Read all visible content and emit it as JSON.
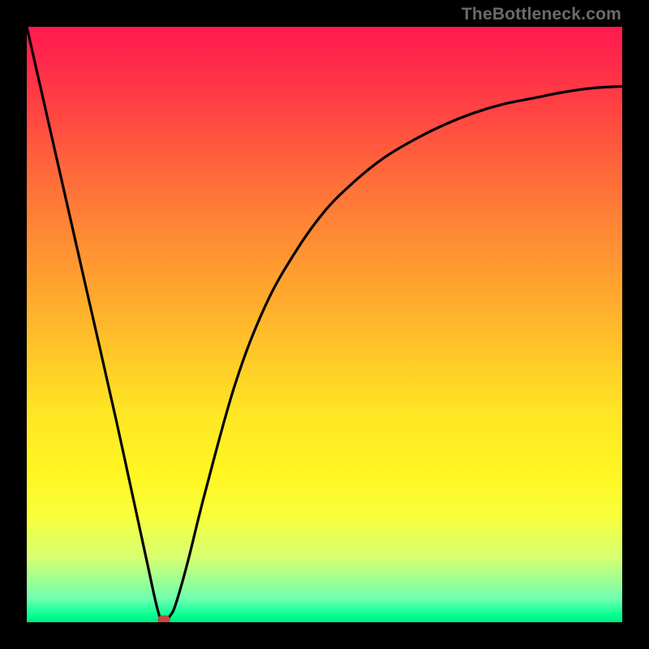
{
  "attribution": "TheBottleneck.com",
  "chart_data": {
    "type": "line",
    "background": "rainbow-gradient",
    "x": [
      0,
      5,
      10,
      15,
      20,
      22,
      23,
      24,
      25,
      27,
      30,
      35,
      40,
      45,
      50,
      55,
      60,
      65,
      70,
      75,
      80,
      85,
      90,
      95,
      100
    ],
    "y": [
      100,
      78,
      56,
      34,
      11,
      2,
      0,
      1,
      3,
      10,
      22,
      40,
      53,
      62,
      69,
      74,
      78,
      81,
      83.5,
      85.5,
      87,
      88,
      89,
      89.7,
      90
    ],
    "xlim": [
      0,
      100
    ],
    "ylim": [
      0,
      100
    ],
    "xlabel": "",
    "ylabel": "",
    "title": "",
    "marker_point": {
      "x": 23,
      "y": 0
    },
    "notes": "V-shaped curve: steep linear descent from top-left to minimum near x≈23, then concave rise approaching ~90 at right edge. Background is vertical red→orange→yellow→green gradient."
  },
  "colors": {
    "frame": "#000000",
    "curve": "#000000",
    "marker": "#c74642",
    "attribution_text": "#6b6b6b"
  }
}
